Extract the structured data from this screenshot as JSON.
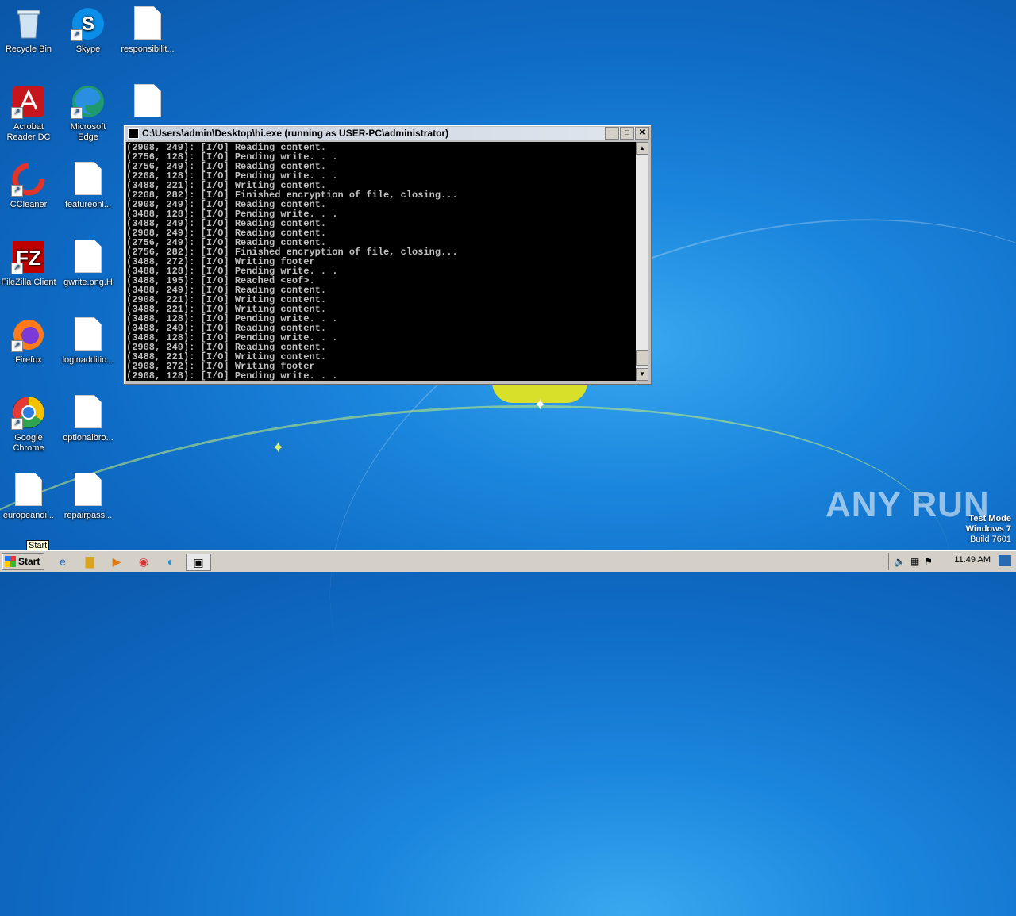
{
  "desktop": {
    "icons": [
      {
        "label": "Recycle Bin",
        "icon": "recycle-bin-icon"
      },
      {
        "label": "Skype",
        "icon": "skype-icon"
      },
      {
        "label": "responsibilit...",
        "icon": "file-icon"
      },
      {
        "label": "Acrobat Reader DC",
        "icon": "acrobat-icon"
      },
      {
        "label": "Microsoft Edge",
        "icon": "edge-icon"
      },
      {
        "label": "",
        "icon": "file-icon"
      },
      {
        "label": "CCleaner",
        "icon": "ccleaner-icon"
      },
      {
        "label": "featureonl...",
        "icon": "file-icon"
      },
      {
        "label": "FileZilla Client",
        "icon": "filezilla-icon"
      },
      {
        "label": "gwrite.png.H",
        "icon": "file-icon"
      },
      {
        "label": "Firefox",
        "icon": "firefox-icon"
      },
      {
        "label": "loginadditio...",
        "icon": "file-icon"
      },
      {
        "label": "Google Chrome",
        "icon": "chrome-icon"
      },
      {
        "label": "optionalbro...",
        "icon": "file-icon"
      },
      {
        "label": "europeandi...",
        "icon": "file-icon"
      },
      {
        "label": "repairpass...",
        "icon": "file-icon"
      }
    ]
  },
  "console": {
    "title": "C:\\Users\\admin\\Desktop\\hi.exe (running as USER-PC\\administrator)",
    "buttons": {
      "minimize": "_",
      "maximize": "□",
      "close": "✕"
    },
    "lines": [
      "(2908, 249): [I/O] Reading content.",
      "(2756, 128): [I/O] Pending write. . .",
      "(2756, 249): [I/O] Reading content.",
      "(2208, 128): [I/O] Pending write. . .",
      "(3488, 221): [I/O] Writing content.",
      "(2208, 282): [I/O] Finished encryption of file, closing...",
      "(2908, 249): [I/O] Reading content.",
      "(3488, 128): [I/O] Pending write. . .",
      "(3488, 249): [I/O] Reading content.",
      "(2908, 249): [I/O] Reading content.",
      "(2756, 249): [I/O] Reading content.",
      "(2756, 282): [I/O] Finished encryption of file, closing...",
      "(3488, 272): [I/O] Writing footer",
      "(3488, 128): [I/O] Pending write. . .",
      "(3488, 195): [I/O] Reached <eof>.",
      "(3488, 249): [I/O] Reading content.",
      "(2908, 221): [I/O] Writing content.",
      "(3488, 221): [I/O] Writing content.",
      "(3488, 128): [I/O] Pending write. . .",
      "(3488, 249): [I/O] Reading content.",
      "(3488, 128): [I/O] Pending write. . .",
      "(2908, 249): [I/O] Reading content.",
      "(3488, 221): [I/O] Writing content.",
      "(2908, 272): [I/O] Writing footer",
      "(2908, 128): [I/O] Pending write. . ."
    ]
  },
  "watermark": {
    "text": "ANY RUN"
  },
  "system": {
    "mode": "Test Mode",
    "os": "Windows 7",
    "build": "Build 7601"
  },
  "taskbar": {
    "start_label": "Start",
    "tooltip": "Start",
    "apps": [
      "ie-icon",
      "explorer-icon",
      "media-player-icon",
      "chrome-icon",
      "edge-icon",
      "console-icon"
    ],
    "clock": "11:49 AM"
  }
}
